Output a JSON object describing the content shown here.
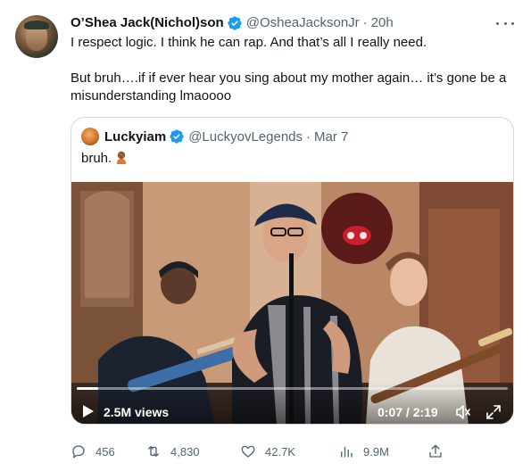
{
  "tweet": {
    "author_name": "O’Shea Jack(Nichol)son",
    "author_handle": "@OsheaJacksonJr",
    "separator": "·",
    "time": "20h",
    "line1": "I respect logic. I think he can rap. And that’s all I really need.",
    "line2": "But bruh….if if ever hear you sing about my mother again… it’s gone be a misunderstanding lmaoooo"
  },
  "quote": {
    "author_name": "Luckyiam",
    "author_handle": "@LuckyovLegends",
    "separator": "·",
    "date": "Mar 7",
    "text": "bruh.",
    "video": {
      "views": "2.5M views",
      "duration": "0:07 / 2:19",
      "progress": 0.05
    }
  },
  "actions": {
    "replies": "456",
    "retweets": "4,830",
    "likes": "42.7K",
    "views": "9.9M"
  },
  "colors": {
    "verified": "#1d9bf0",
    "muted": "#536471",
    "border": "#cfd9de"
  }
}
